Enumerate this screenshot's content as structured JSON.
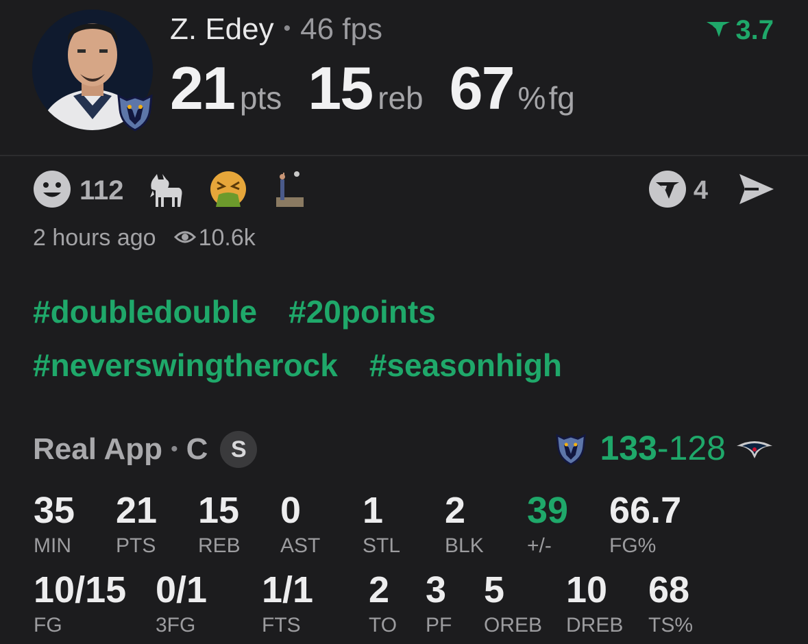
{
  "player": {
    "name": "Z. Edey",
    "fps": "46 fps",
    "rating": "3.7",
    "pts": "21",
    "pts_unit": "pts",
    "reb": "15",
    "reb_unit": "reb",
    "fg": "67",
    "fg_unit": "%",
    "fg_suffix": "fg"
  },
  "reactions": {
    "smile_count": "112",
    "items": [
      "smile-icon",
      "goat-icon",
      "vomit-icon",
      "dunk-image"
    ],
    "comment_count": "4"
  },
  "meta": {
    "time": "2 hours ago",
    "views": "10.6k"
  },
  "hashtags": {
    "line1": [
      "#doubledouble",
      "#20points"
    ],
    "line2": [
      "#neverswingtherock",
      "#seasonhigh"
    ]
  },
  "game": {
    "app": "Real App",
    "position": "C",
    "starter": "S",
    "home_score": "133",
    "dash": "-",
    "away_score": "128"
  },
  "stats_row1": [
    {
      "value": "35",
      "label": "MIN"
    },
    {
      "value": "21",
      "label": "PTS"
    },
    {
      "value": "15",
      "label": "REB"
    },
    {
      "value": "0",
      "label": "AST"
    },
    {
      "value": "1",
      "label": "STL"
    },
    {
      "value": "2",
      "label": "BLK"
    },
    {
      "value": "39",
      "label": "+/-"
    },
    {
      "value": "66.7",
      "label": "FG%"
    }
  ],
  "stats_row2": [
    {
      "value": "10/15",
      "label": "FG"
    },
    {
      "value": "0/1",
      "label": "3FG"
    },
    {
      "value": "1/1",
      "label": "FTS"
    },
    {
      "value": "2",
      "label": "TO"
    },
    {
      "value": "3",
      "label": "PF"
    },
    {
      "value": "5",
      "label": "OREB"
    },
    {
      "value": "10",
      "label": "DREB"
    },
    {
      "value": "68",
      "label": "TS%"
    }
  ],
  "colors": {
    "background": "#1c1c1e",
    "accent_green": "#1fa86a",
    "muted_text": "#a3a3a6"
  }
}
